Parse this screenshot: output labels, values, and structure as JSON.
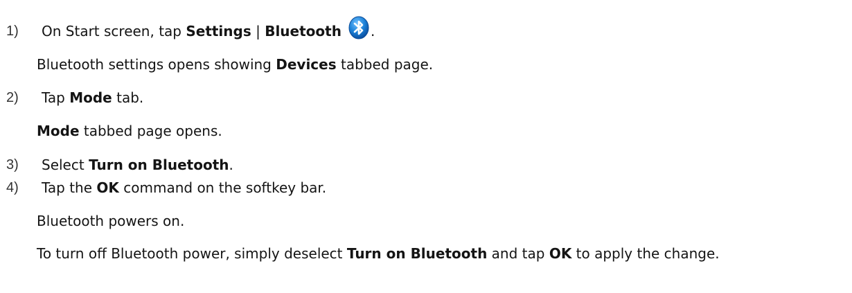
{
  "steps": [
    {
      "number": "1)",
      "pre": "On Start screen, tap ",
      "bold1": "Settings",
      "mid": " | ",
      "bold2": "Bluetooth",
      "post": ".",
      "icon": "bluetooth-icon",
      "result": {
        "pre": "Bluetooth settings opens showing ",
        "bold": "Devices",
        "post": " tabbed page."
      }
    },
    {
      "number": "2)",
      "pre": "Tap ",
      "bold": "Mode",
      "post": " tab.",
      "result": {
        "bold": "Mode",
        "post": " tabbed page opens."
      }
    },
    {
      "number": "3)",
      "pre": "Select ",
      "bold": "Turn on Bluetooth",
      "post": "."
    },
    {
      "number": "4)",
      "pre": "Tap the ",
      "bold": "OK",
      "post": " command on the softkey bar.",
      "result": {
        "text": "Bluetooth powers on."
      }
    }
  ],
  "note": {
    "pre": "To turn off Bluetooth power, simply deselect ",
    "bold1": "Turn on Bluetooth",
    "mid": " and tap ",
    "bold2": "OK",
    "post": " to apply the change."
  },
  "colors": {
    "text": "#141414",
    "icon_blue": "#1a7fd6"
  }
}
